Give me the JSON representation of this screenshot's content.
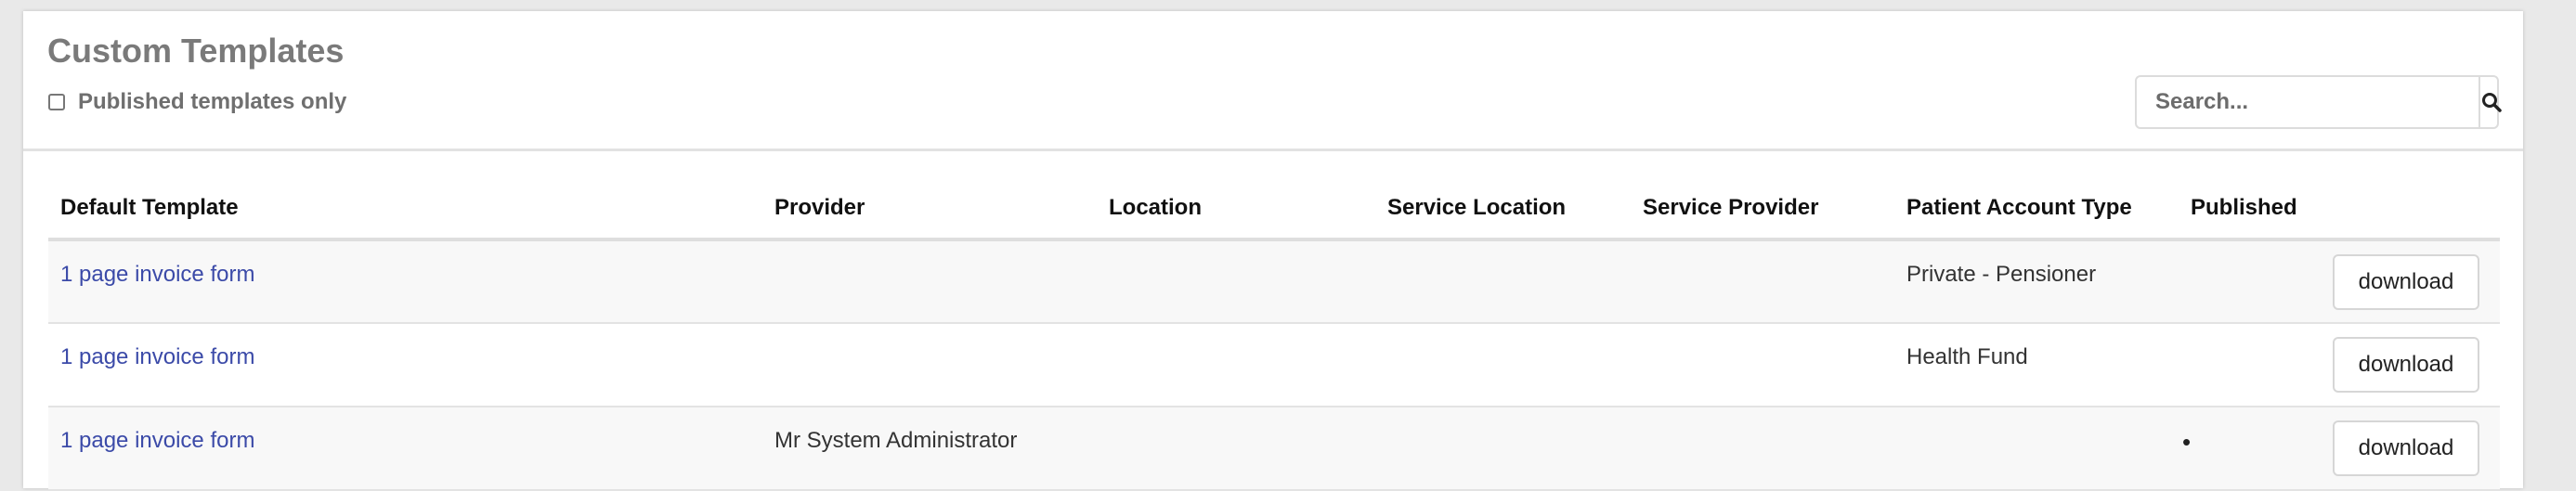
{
  "panel": {
    "title": "Custom Templates",
    "filter_label": "Published templates only",
    "filter_checked": false,
    "search": {
      "placeholder": "Search...",
      "icon": "search-icon"
    }
  },
  "table": {
    "columns": [
      "Default Template",
      "Provider",
      "Location",
      "Service Location",
      "Service Provider",
      "Patient Account Type",
      "Published",
      ""
    ],
    "rows": [
      {
        "template": "1 page invoice form",
        "provider": "",
        "location": "",
        "service_location": "",
        "service_provider": "",
        "patient_account_type": "Private - Pensioner",
        "published": "",
        "action": "download"
      },
      {
        "template": "1 page invoice form",
        "provider": "",
        "location": "",
        "service_location": "",
        "service_provider": "",
        "patient_account_type": "Health Fund",
        "published": "",
        "action": "download"
      },
      {
        "template": "1 page invoice form",
        "provider": "Mr System Administrator",
        "location": "",
        "service_location": "",
        "service_provider": "",
        "patient_account_type": "",
        "published": "•",
        "action": "download"
      }
    ]
  },
  "colors": {
    "link": "#3b4aa8",
    "title": "#7a7a7a",
    "background": "#e9e9e9"
  }
}
